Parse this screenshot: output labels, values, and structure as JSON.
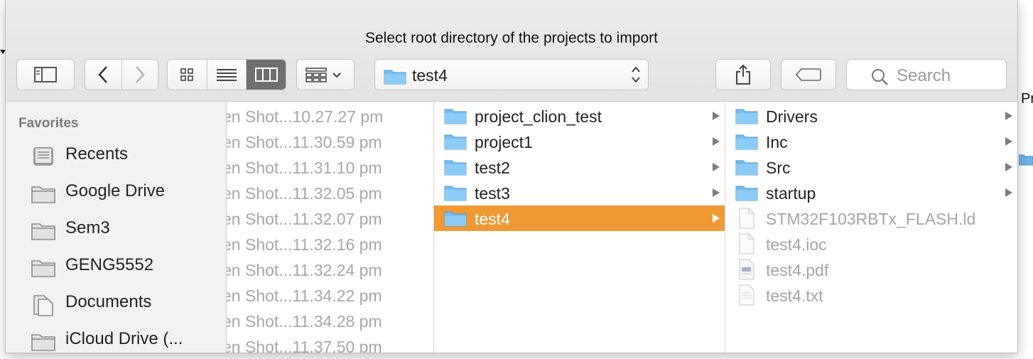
{
  "background": {
    "right_edge_text": "Pr"
  },
  "dialog": {
    "title": "Select root directory of the projects to import",
    "toolbar": {
      "path_popup_value": "test4",
      "search_placeholder": "Search"
    },
    "sidebar": {
      "section_title": "Favorites",
      "items": [
        {
          "label": "Recents",
          "icon": "recents-icon"
        },
        {
          "label": "Google Drive",
          "icon": "folder-icon"
        },
        {
          "label": "Sem3",
          "icon": "folder-icon"
        },
        {
          "label": "GENG5552",
          "icon": "folder-icon"
        },
        {
          "label": "Documents",
          "icon": "documents-icon"
        },
        {
          "label": "iCloud Drive (...",
          "icon": "folder-icon"
        }
      ]
    },
    "column1": {
      "items": [
        "en Shot...10.27.27 pm",
        "en Shot...11.30.59 pm",
        "en Shot...11.31.10 pm",
        "en Shot...11.32.05 pm",
        "en Shot...11.32.07 pm",
        "en Shot...11.32.16 pm",
        "en Shot...11.32.24 pm",
        "en Shot...11.34.22 pm",
        "en Shot...11.34.28 pm",
        "en Shot...11.37.50 pm"
      ]
    },
    "column2": {
      "items": [
        {
          "label": "project_clion_test",
          "selected": false
        },
        {
          "label": "project1",
          "selected": false
        },
        {
          "label": "test2",
          "selected": false
        },
        {
          "label": "test3",
          "selected": false
        },
        {
          "label": "test4",
          "selected": true
        }
      ],
      "selection_color": "#f09a36"
    },
    "column3": {
      "items": [
        {
          "label": "Drivers",
          "type": "folder"
        },
        {
          "label": "Inc",
          "type": "folder"
        },
        {
          "label": "Src",
          "type": "folder"
        },
        {
          "label": "startup",
          "type": "folder"
        },
        {
          "label": "STM32F103RBTx_FLASH.ld",
          "type": "file"
        },
        {
          "label": "test4.ioc",
          "type": "file"
        },
        {
          "label": "test4.pdf",
          "type": "pdf"
        },
        {
          "label": "test4.txt",
          "type": "text"
        }
      ]
    }
  }
}
